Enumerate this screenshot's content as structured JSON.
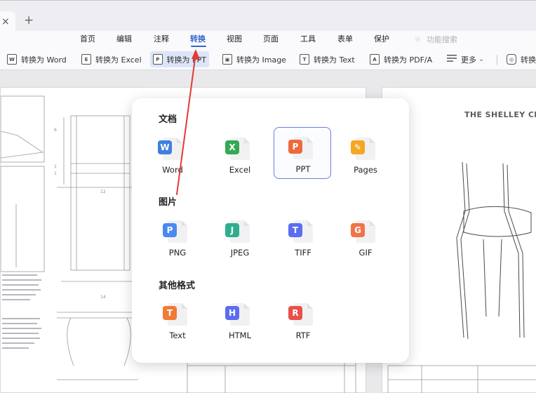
{
  "tab_bar": {
    "close_glyph": "×",
    "new_tab_glyph": "+"
  },
  "menu": {
    "items": [
      "首页",
      "编辑",
      "注释",
      "转换",
      "视图",
      "页面",
      "工具",
      "表单",
      "保护"
    ],
    "active": "转换",
    "search_placeholder": "功能搜索",
    "search_icon": "lightbulb-icon"
  },
  "toolbar": {
    "buttons": [
      {
        "label": "转换为 Word",
        "icon": "word-doc-icon",
        "icon_glyph": "W"
      },
      {
        "label": "转换为 Excel",
        "icon": "excel-doc-icon",
        "icon_glyph": "E"
      },
      {
        "label": "转换为 PPT",
        "icon": "ppt-doc-icon",
        "icon_glyph": "P",
        "active": true
      },
      {
        "label": "转换为 Image",
        "icon": "image-doc-icon",
        "icon_glyph": "▣"
      },
      {
        "label": "转换为 Text",
        "icon": "text-doc-icon",
        "icon_glyph": "T"
      },
      {
        "label": "转换为 PDF/A",
        "icon": "pdfa-doc-icon",
        "icon_glyph": "A"
      },
      {
        "label": "更多",
        "icon": "list-icon",
        "chevron": "⌄"
      },
      {
        "label": "转换",
        "icon": "settings-hex-icon",
        "icon_glyph": "◎"
      }
    ]
  },
  "document": {
    "right_page_title": "THE SHELLEY CHA"
  },
  "popup": {
    "sections": [
      {
        "title": "文档",
        "items": [
          {
            "label": "Word",
            "letter": "W",
            "color": "#3f7fe0",
            "icon": "word-file-icon"
          },
          {
            "label": "Excel",
            "letter": "X",
            "color": "#34a853",
            "icon": "excel-file-icon"
          },
          {
            "label": "PPT",
            "letter": "P",
            "color": "#ee6a3b",
            "icon": "ppt-file-icon",
            "selected": true
          },
          {
            "label": "Pages",
            "letter": "✎",
            "color": "#f5a623",
            "icon": "pages-file-icon"
          }
        ]
      },
      {
        "title": "图片",
        "items": [
          {
            "label": "PNG",
            "letter": "P",
            "color": "#4a8af0",
            "icon": "png-file-icon"
          },
          {
            "label": "JPEG",
            "letter": "J",
            "color": "#2fae8f",
            "icon": "jpeg-file-icon"
          },
          {
            "label": "TIFF",
            "letter": "T",
            "color": "#5b6ef0",
            "icon": "tiff-file-icon"
          },
          {
            "label": "GIF",
            "letter": "G",
            "color": "#f0734a",
            "icon": "gif-file-icon"
          }
        ]
      },
      {
        "title": "其他格式",
        "items": [
          {
            "label": "Text",
            "letter": "T",
            "color": "#f07a36",
            "icon": "text-file-icon"
          },
          {
            "label": "HTML",
            "letter": "H",
            "color": "#5b6ef0",
            "icon": "html-file-icon"
          },
          {
            "label": "RTF",
            "letter": "R",
            "color": "#e9504a",
            "icon": "rtf-file-icon"
          }
        ]
      }
    ]
  },
  "annotation": {
    "arrow_color": "#e53935"
  }
}
